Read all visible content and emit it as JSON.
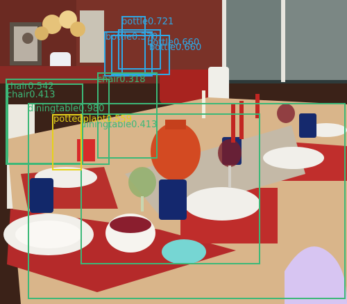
{
  "detections": [
    {
      "label_text": "bottle0.721",
      "color": "#2ea8e6"
    },
    {
      "label_text": "bottle0.370",
      "color": "#2ea8e6"
    },
    {
      "label_text": "bottle0.660",
      "color": "#2ea8e6"
    },
    {
      "label_text": "bottle0.660",
      "color": "#2ea8e6"
    },
    {
      "label_text": "chair0.542",
      "color": "#3cb878"
    },
    {
      "label_text": "chair0.318",
      "color": "#3cb878"
    },
    {
      "label_text": "chair0.413",
      "color": "#3cb878"
    },
    {
      "label_text": "diningtable0.980",
      "color": "#3cb878"
    },
    {
      "label_text": "diningtable0.413",
      "color": "#3cb878"
    },
    {
      "label_text": "pottedplant0.559",
      "color": "#e6d21a"
    }
  ]
}
